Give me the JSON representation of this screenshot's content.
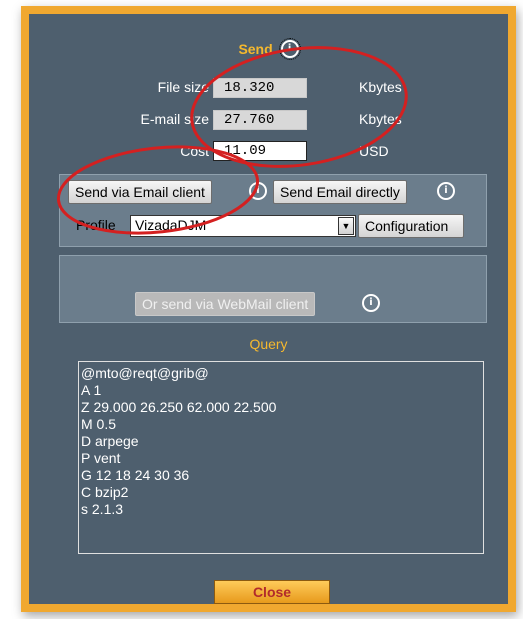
{
  "send_section": {
    "title": "Send",
    "info_glyph": "i",
    "rows": [
      {
        "label": "File size",
        "value": "18.320",
        "unit": "Kbytes"
      },
      {
        "label": "E-mail size",
        "value": "27.760",
        "unit": "Kbytes"
      },
      {
        "label": "Cost",
        "value": "11.09",
        "unit": "USD"
      }
    ]
  },
  "email_box": {
    "send_via_client_label": "Send via Email client",
    "send_directly_label": "Send Email directly",
    "profile_label": "Profile",
    "profile_selected": "VizadaDJM",
    "configuration_label": "Configuration"
  },
  "webmail_box": {
    "webmail_label": "Or send via WebMail client"
  },
  "query": {
    "title": "Query",
    "lines": [
      "@mto@reqt@grib@",
      "A 1",
      "Z 29.000 26.250 62.000 22.500",
      "M 0.5",
      "D arpege",
      "P vent",
      "G 12 18 24 30 36",
      "C bzip2",
      "s 2.1.3"
    ]
  },
  "footer": {
    "close_label": "Close"
  },
  "colors": {
    "frame": "#f0a830",
    "panel": "#4e5f6e",
    "title": "#f5b82e",
    "annotation": "#d42020"
  }
}
